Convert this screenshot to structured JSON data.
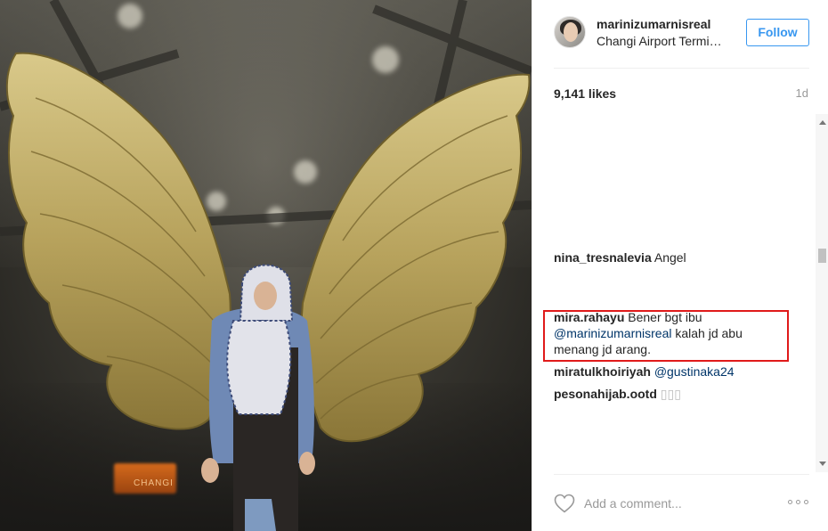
{
  "post": {
    "username": "marinizumarnisreal",
    "location": "Changi Airport Termi…",
    "follow_label": "Follow",
    "likes": "9,141 likes",
    "time_ago": "1d",
    "photo_sign_text": "CHANGI"
  },
  "comments": [
    {
      "user": "nina_tresnalevia",
      "text": "Angel"
    },
    {
      "user": "mira.rahayu",
      "text_before": "Bener bgt ibu",
      "mention": "@marinizumarnisreal",
      "text_after": "kalah jd abu menang jd arang."
    },
    {
      "user": "miratulkhoiriyah",
      "mention": "@gustinaka24"
    },
    {
      "user": "pesonahijab.ootd",
      "text": "▯▯▯"
    }
  ],
  "footer": {
    "comment_placeholder": "Add a comment...",
    "like_icon": "heart-icon",
    "more_icon": "more-options-icon"
  },
  "colors": {
    "accent": "#3897f0",
    "mention": "#003569",
    "highlight_box": "#e01a1a",
    "text": "#262626",
    "muted": "#999999"
  }
}
